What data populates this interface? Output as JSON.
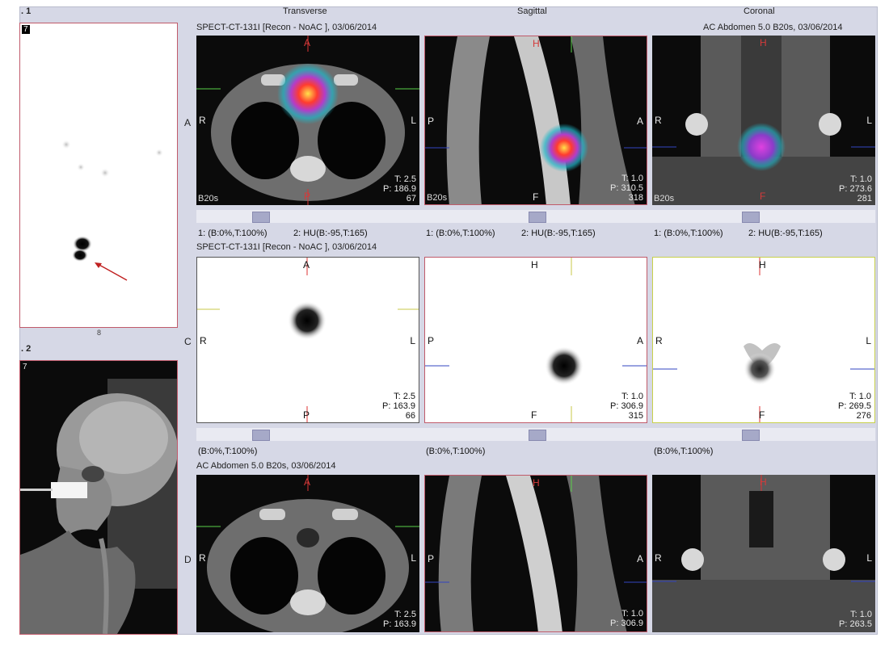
{
  "left": {
    "panel1_title": ". 1",
    "panel1_num": "7",
    "panel1_footer": "8",
    "panel2_title": ". 2",
    "panel2_num": "7"
  },
  "columns": {
    "transverse": "Transverse",
    "sagittal": "Sagittal",
    "coronal": "Coronal"
  },
  "rows": {
    "fused": {
      "header_left": "SPECT-CT-131I [Recon - NoAC ], 03/06/2014",
      "header_right": "AC  Abdomen  5.0  B20s, 03/06/2014",
      "transverse": {
        "top": "A",
        "bottom": "P",
        "left": "R",
        "right": "L",
        "t": "T: 2.5",
        "p": "P: 186.9",
        "n": "67",
        "tag": "B20s"
      },
      "sagittal": {
        "top": "H",
        "bottom": "F",
        "left": "P",
        "right": "A",
        "t": "T: 1.0",
        "p": "P: 310.5",
        "n": "318",
        "tag": "B20s"
      },
      "coronal": {
        "top": "H",
        "bottom": "F",
        "left": "R",
        "right": "L",
        "t": "T: 1.0",
        "p": "P: 273.6",
        "n": "281",
        "tag": "B20s"
      },
      "win1": "1: (B:0%,T:100%)",
      "win2": "2: HU(B:-95,T:165)"
    },
    "spect": {
      "header_left": "SPECT-CT-131I [Recon - NoAC ], 03/06/2014",
      "transverse": {
        "top": "A",
        "bottom": "P",
        "left": "R",
        "right": "L",
        "t": "T: 2.5",
        "p": "P: 163.9",
        "n": "66"
      },
      "sagittal": {
        "top": "H",
        "bottom": "F",
        "left": "P",
        "right": "A",
        "t": "T: 1.0",
        "p": "P: 306.9",
        "n": "315"
      },
      "coronal": {
        "top": "H",
        "bottom": "F",
        "left": "R",
        "right": "L",
        "t": "T: 1.0",
        "p": "P: 269.5",
        "n": "276"
      },
      "win": "(B:0%,T:100%)"
    },
    "ct": {
      "header_left": "AC  Abdomen  5.0  B20s, 03/06/2014",
      "transverse": {
        "top": "A",
        "left": "R",
        "right": "L",
        "t": "T: 2.5",
        "p": "P: 163.9"
      },
      "sagittal": {
        "top": "H",
        "left": "P",
        "right": "A",
        "t": "T: 1.0",
        "p": "P: 306.9"
      },
      "coronal": {
        "top": "H",
        "left": "R",
        "right": "L",
        "t": "T: 1.0",
        "p": "P: 263.5"
      }
    }
  },
  "row_letters": {
    "a": "A",
    "c": "C",
    "d": "D"
  }
}
